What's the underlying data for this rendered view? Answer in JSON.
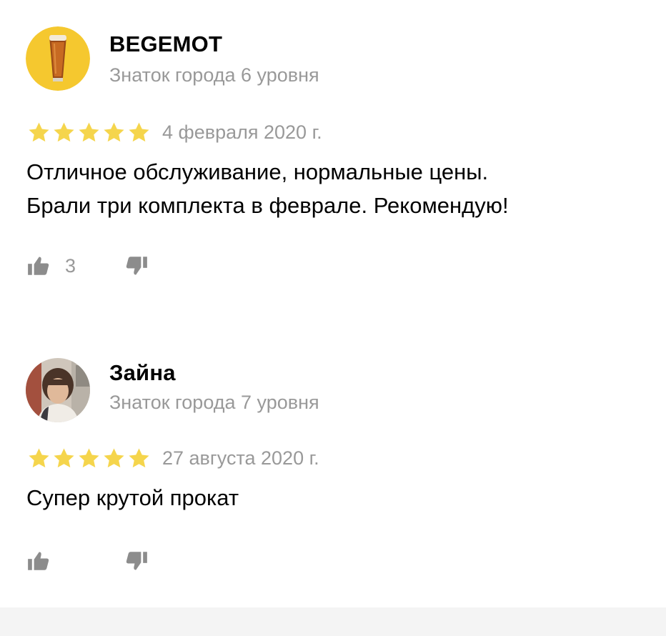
{
  "reviews": [
    {
      "author": "BEGEMOT",
      "level": "Знаток города 6 уровня",
      "rating": 5,
      "date": "4 февраля 2020 г.",
      "text": "Отличное обслуживание, нормальные цены. Брали три комплекта в феврале. Рекомендую!",
      "likes": "3",
      "avatar_icon": "beer-glass-icon"
    },
    {
      "author": "Зайна",
      "level": "Знаток города 7 уровня",
      "rating": 5,
      "date": "27 августа 2020 г.",
      "text": "Супер крутой прокат",
      "likes": "",
      "avatar_icon": "user-photo"
    }
  ],
  "colors": {
    "star": "#f5d54c",
    "muted_text": "#999999",
    "icon": "#8c8c8c",
    "avatar_bg_1": "#f5c82f"
  }
}
